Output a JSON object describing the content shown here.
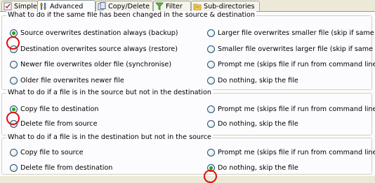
{
  "tabs": [
    {
      "label": "Simple",
      "icon": "checklist-icon"
    },
    {
      "label": "Advanced",
      "icon": "advanced-settings-icon"
    },
    {
      "label": "Copy/Delete",
      "icon": "copy-delete-icon"
    },
    {
      "label": "Filter",
      "icon": "funnel-icon"
    },
    {
      "label": "Sub-directories",
      "icon": "subdirectories-icon"
    }
  ],
  "groups": [
    {
      "title": "What to do if the same file has been changed in the source & destination",
      "options": [
        "Source overwrites destination always (backup)",
        "Larger file overwrites smaller file (skip if same size)",
        "Destination overwrites source always (restore)",
        "Smaller file overwrites larger file (skip if same size)",
        "Newer file overwrites older file (synchronise)",
        "Prompt me (skips file if run from command line)",
        "Older file overwrites newer file",
        "Do nothing, skip the file"
      ],
      "selected": "Source overwrites destination always (backup)"
    },
    {
      "title": "What to do if a file is in the source but not in the destination",
      "options": [
        "Copy file to destination",
        "Prompt me (skips file if run from command line)",
        "Delete file from source",
        "Do nothing, skip the file"
      ],
      "selected": "Copy file to destination"
    },
    {
      "title": "What to do if a file is in the destination but not in the source",
      "options": [
        "Copy file to source",
        "Prompt me (skips file if run from command line)",
        "Delete file from destination",
        "Do nothing, skip the file"
      ],
      "selected": "Do nothing, skip the file"
    }
  ],
  "colors": {
    "highlight_ring": "#e01010",
    "radio_dot": "#21a121"
  }
}
